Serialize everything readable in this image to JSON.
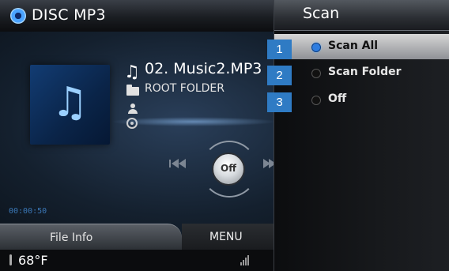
{
  "header": {
    "source_label": "DISC MP3",
    "source_icon": "disc-icon"
  },
  "now_playing": {
    "track_title": "02. Music2.MP3",
    "folder": "ROOT FOLDER",
    "play_time": "00:00:50",
    "control_center_label": "Off",
    "icons": [
      "music-note-icon",
      "folder-icon",
      "artist-icon",
      "album-icon",
      "previous-track-icon",
      "next-track-icon"
    ]
  },
  "scan_menu": {
    "title": "Scan",
    "selected_index": 0,
    "options": [
      {
        "label": "Scan All",
        "badge": "1"
      },
      {
        "label": "Scan Folder",
        "badge": "2"
      },
      {
        "label": "Off",
        "badge": "3"
      }
    ]
  },
  "bottom_bar": {
    "file_info_label": "File Info",
    "menu_label": "MENU"
  },
  "status": {
    "temperature": "68°F",
    "signal_icon": "signal-icon"
  },
  "colors": {
    "badge": "#2f7bc4",
    "selected_radio": "#2e7de0",
    "accent_blue": "#3b78b8"
  }
}
